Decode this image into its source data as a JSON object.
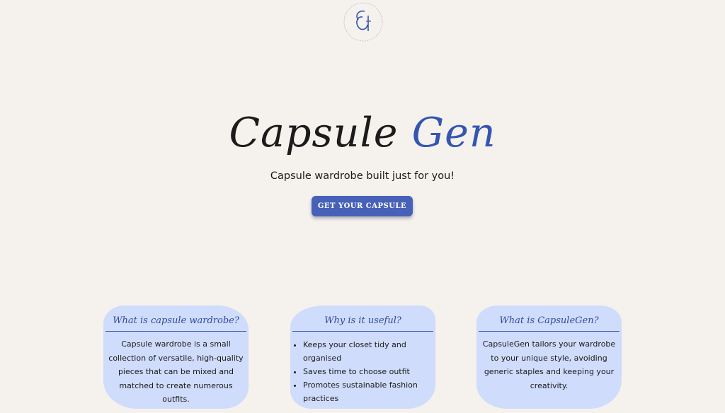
{
  "hero": {
    "title_main": "Capsule",
    "title_accent": "Gen",
    "subtitle": "Capsule wardrobe built just for you!",
    "cta_label": "GET YOUR CAPSULE"
  },
  "cards": [
    {
      "title": "What is capsule wardrobe?",
      "text": "Capsule wardrobe is a small collection of versatile, high-quality pieces that can be mixed and matched to create numerous outfits."
    },
    {
      "title": "Why is it useful?",
      "items": [
        "Keeps your closet tidy and organised",
        "Saves time to choose outfit",
        "Promotes sustainable fashion practices"
      ]
    },
    {
      "title": "What is CapsuleGen?",
      "text": "CapsuleGen tailors your wardrobe to your unique style, avoiding generic staples and keeping your creativity."
    }
  ],
  "colors": {
    "background": "#f5f1ed",
    "accent": "#3556b0",
    "button": "#4861b8",
    "card": "#cfdcfb"
  },
  "icons": {
    "logo": "capsulegen-logo-icon"
  }
}
